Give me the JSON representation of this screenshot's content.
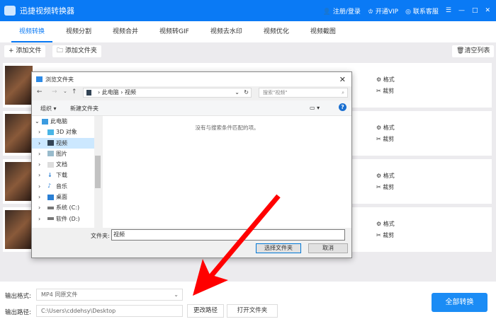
{
  "app": {
    "title": "迅捷视频转换器",
    "login": "注册/登录",
    "vip": "开通VIP",
    "support": "联系客服"
  },
  "tabs": [
    "视频转换",
    "视频分割",
    "视频合并",
    "视频转GIF",
    "视频去水印",
    "视频优化",
    "视频截图"
  ],
  "toolbar": {
    "add_file": "+ 添加文件",
    "add_folder": "添加文件夹",
    "clear": "清空列表"
  },
  "rows": [
    {
      "format": "格式",
      "trim": "裁剪"
    },
    {
      "format": "格式",
      "trim": "裁剪"
    },
    {
      "format": "格式",
      "trim": "裁剪"
    },
    {
      "format": "格式",
      "trim": "裁剪"
    }
  ],
  "dialog": {
    "title": "浏览文件夹",
    "path": [
      "此电脑",
      "视频"
    ],
    "search_placeholder": "搜索\"视频\"",
    "organize": "组织 ▾",
    "new_folder": "新建文件夹",
    "empty": "没有与搜索条件匹配的项。",
    "tree": [
      "此电脑",
      "3D 对象",
      "视频",
      "图片",
      "文档",
      "下载",
      "音乐",
      "桌面",
      "系统 (C:)",
      "软件 (D:)"
    ],
    "folder_label": "文件夹:",
    "folder_value": "视频",
    "select": "选择文件夹",
    "cancel": "取消"
  },
  "bottom": {
    "format_label": "输出格式:",
    "format_value": "MP4  同原文件",
    "path_label": "输出路径:",
    "path_value": "C:\\Users\\cddehsy\\Desktop",
    "change_path": "更改路径",
    "open_folder": "打开文件夹",
    "convert_all": "全部转换"
  },
  "colors": {
    "accent": "#0a7af5",
    "arrow": "#ff0000"
  }
}
